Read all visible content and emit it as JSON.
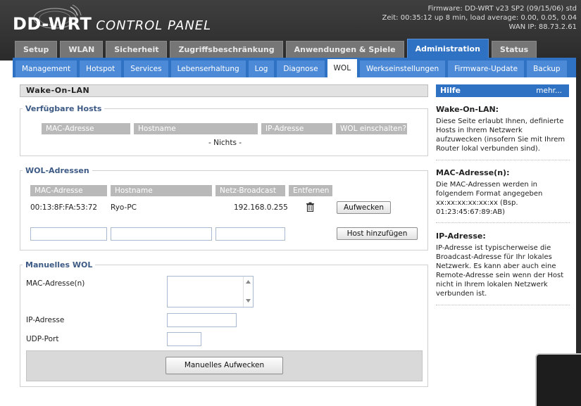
{
  "header": {
    "logo_brand": "DD-WRT",
    "logo_subtitle": "CONTROL PANEL",
    "firmware": "Firmware: DD-WRT v23 SP2 (09/15/06) std",
    "uptime": "Zeit: 00:35:12 up 8 min, load average: 0.00, 0.05, 0.04",
    "wan_ip": "WAN IP: 88.73.2.61"
  },
  "main_tabs": [
    {
      "label": "Setup"
    },
    {
      "label": "WLAN"
    },
    {
      "label": "Sicherheit"
    },
    {
      "label": "Zugriffsbeschränkung"
    },
    {
      "label": "Anwendungen & Spiele"
    },
    {
      "label": "Administration"
    },
    {
      "label": "Status"
    }
  ],
  "sub_tabs": [
    {
      "label": "Management"
    },
    {
      "label": "Hotspot"
    },
    {
      "label": "Services"
    },
    {
      "label": "Lebenserhaltung"
    },
    {
      "label": "Log"
    },
    {
      "label": "Diagnose"
    },
    {
      "label": "WOL"
    },
    {
      "label": "Werkseinstellungen"
    },
    {
      "label": "Firmware-Update"
    },
    {
      "label": "Backup"
    }
  ],
  "page_title": "Wake-On-LAN",
  "hosts": {
    "legend": "Verfügbare Hosts",
    "columns": [
      "MAC-Adresse",
      "Hostname",
      "IP-Adresse",
      "WOL einschalten?"
    ],
    "empty_text": "- Nichts -"
  },
  "wol_addresses": {
    "legend": "WOL-Adressen",
    "columns": [
      "MAC-Adresse",
      "Hostname",
      "Netz-Broadcast",
      "Entfernen"
    ],
    "rows": [
      {
        "mac": "00:13:8F:FA:53:72",
        "hostname": "Ryo-PC",
        "broadcast": "192.168.0.255",
        "wake_label": "Aufwecken"
      }
    ],
    "add_label": "Host hinzufügen"
  },
  "manual_wol": {
    "legend": "Manuelles WOL",
    "mac_label": "MAC-Adresse(n)",
    "ip_label": "IP-Adresse",
    "udp_label": "UDP-Port",
    "wake_label": "Manuelles Aufwecken"
  },
  "help": {
    "title": "Hilfe",
    "more": "mehr...",
    "sections": [
      {
        "title": "Wake-On-LAN:",
        "text": "Diese Seite erlaubt Ihnen, definierte Hosts in Ihrem Netzwerk aufzuwecken (insofern Sie mit Ihrem Router lokal verbunden sind)."
      },
      {
        "title": "MAC-Adresse(n):",
        "text": "Die MAC-Adressen werden in folgendem Format angegeben xx:xx:xx:xx:xx:xx (Bsp. 01:23:45:67:89:AB)"
      },
      {
        "title": "IP-Adresse:",
        "text": "IP-Adresse ist typischerweise die Broadcast-Adresse für Ihr lokales Netzwerk. Es kann aber auch eine Remote-Adresse sein wenn der Host nicht in Ihrem lokalen Netzwerk verbunden ist."
      }
    ]
  },
  "colors": {
    "accent": "#2f72c4",
    "header_bg": "#3a3a3a",
    "legend_text": "#3d5a85"
  }
}
